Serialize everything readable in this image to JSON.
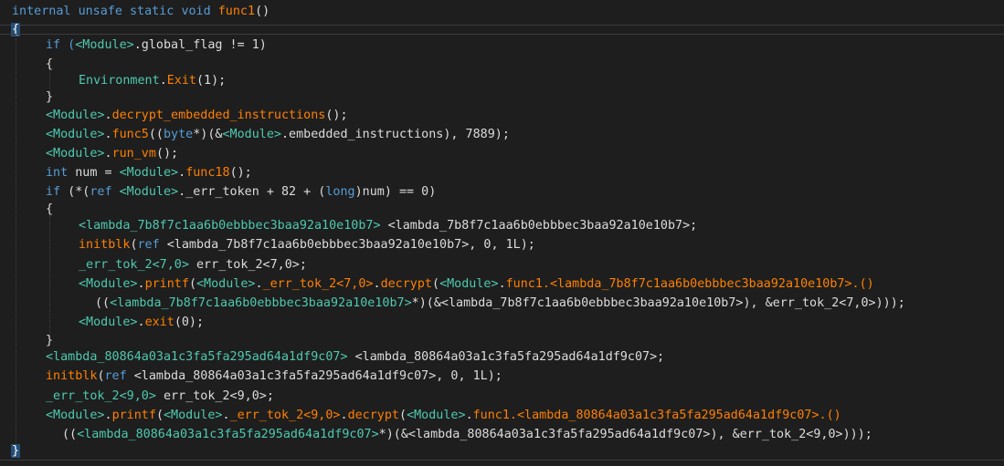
{
  "code": {
    "signature": {
      "kw1": "internal",
      "kw2": "unsafe",
      "kw3": "static",
      "kw4": "void",
      "name": "func1",
      "parens": "()"
    },
    "open_brace": "{",
    "close_brace": "}",
    "lines": [
      [
        "if (",
        "<Module>",
        ".global_flag != 1)"
      ],
      [
        "{"
      ],
      [
        "Environment",
        ".",
        "Exit",
        "(1);"
      ],
      [
        "}"
      ],
      [
        "<Module>",
        ".",
        "decrypt_embedded_instructions",
        "();"
      ],
      [
        "<Module>",
        ".",
        "func5",
        "((",
        "byte",
        "*)(&",
        "<Module>",
        ".embedded_instructions), 7889);"
      ],
      [
        "<Module>",
        ".",
        "run_vm",
        "();"
      ],
      [
        "int",
        " num = ",
        "<Module>",
        ".",
        "func18",
        "();"
      ],
      [
        "if",
        " (*(",
        "ref",
        " ",
        "<Module>",
        "._err_token + 82 + (",
        "long",
        ")num) == 0)"
      ],
      [
        "{"
      ],
      [
        "<lambda_7b8f7c1aa6b0ebbbec3baa92a10e10b7>",
        " <lambda_7b8f7c1aa6b0ebbbec3baa92a10e10b7>;"
      ],
      [
        "initblk",
        "(",
        "ref",
        " <lambda_7b8f7c1aa6b0ebbbec3baa92a10e10b7>, 0, 1L);"
      ],
      [
        "_err_tok_2<7,0>",
        " err_tok_2<7,0>;"
      ],
      [
        "<Module>",
        ".",
        "printf",
        "(",
        "<Module>",
        ".",
        "_err_tok_2<7,0>",
        ".",
        "decrypt",
        "(",
        "<Module>",
        ".",
        "func1.<lambda_7b8f7c1aa6b0ebbbec3baa92a10e10b7>.()"
      ],
      [
        "((",
        "<lambda_7b8f7c1aa6b0ebbbec3baa92a10e10b7>",
        "*)(&<lambda_7b8f7c1aa6b0ebbbec3baa92a10e10b7>), &err_tok_2<7,0>)));"
      ],
      [
        "<Module>",
        ".",
        "exit",
        "(0);"
      ],
      [
        "}"
      ],
      [
        "<lambda_80864a03a1c3fa5fa295ad64a1df9c07>",
        " <lambda_80864a03a1c3fa5fa295ad64a1df9c07>;"
      ],
      [
        "initblk",
        "(",
        "ref",
        " <lambda_80864a03a1c3fa5fa295ad64a1df9c07>, 0, 1L);"
      ],
      [
        "_err_tok_2<9,0>",
        " err_tok_2<9,0>;"
      ],
      [
        "<Module>",
        ".",
        "printf",
        "(",
        "<Module>",
        ".",
        "_err_tok_2<9,0>",
        ".",
        "decrypt",
        "(",
        "<Module>",
        ".",
        "func1.<lambda_80864a03a1c3fa5fa295ad64a1df9c07>.()"
      ],
      [
        "((",
        "<lambda_80864a03a1c3fa5fa295ad64a1df9c07>",
        "*)(&<lambda_80864a03a1c3fa5fa295ad64a1df9c07>), &err_tok_2<9,0>)));"
      ]
    ]
  }
}
